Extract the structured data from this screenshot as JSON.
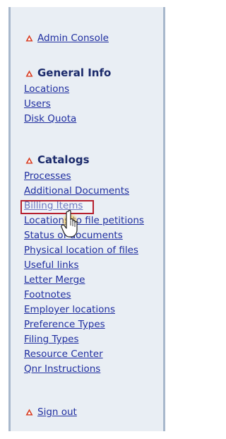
{
  "nav": {
    "admin_console": "Admin Console",
    "general_info": {
      "title": "General Info",
      "items": [
        {
          "label": "Locations"
        },
        {
          "label": "Users"
        },
        {
          "label": "Disk Quota"
        }
      ]
    },
    "catalogs": {
      "title": "Catalogs",
      "items": [
        {
          "label": "Processes"
        },
        {
          "label": "Additional Documents"
        },
        {
          "label": "Billing Items"
        },
        {
          "label": "Locations to file petitions"
        },
        {
          "label": "Status of documents"
        },
        {
          "label": "Physical location of files"
        },
        {
          "label": "Useful links"
        },
        {
          "label": "Letter Merge"
        },
        {
          "label": "Footnotes"
        },
        {
          "label": "Employer locations"
        },
        {
          "label": "Preference Types"
        },
        {
          "label": "Filing Types"
        },
        {
          "label": "Resource Center"
        },
        {
          "label": "Qnr Instructions"
        }
      ]
    },
    "sign_out": "Sign out"
  },
  "icons": {
    "section_marker": "warning-triangle-icon",
    "pointer": "hand-pointer-icon"
  },
  "colors": {
    "panel_bg": "#e9eef4",
    "link": "#1f2ea0",
    "section_title": "#1b2a6b",
    "icon_red": "#d83a1f",
    "highlight_border": "#b6202e"
  },
  "state": {
    "hovered_item": "Billing Items"
  }
}
